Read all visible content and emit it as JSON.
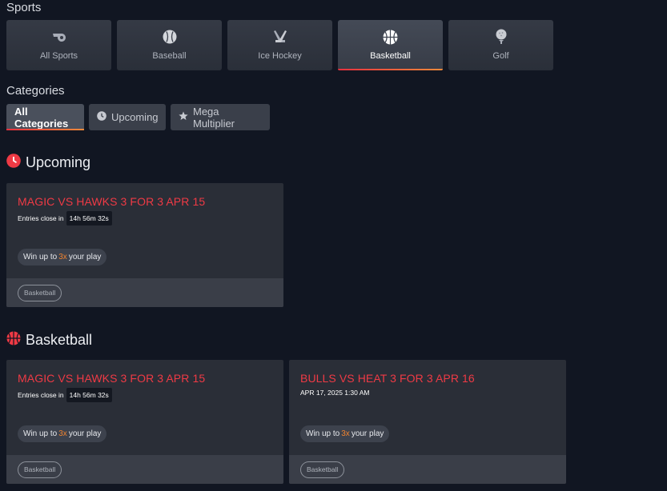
{
  "sports": {
    "title": "Sports",
    "items": [
      {
        "label": "All Sports",
        "icon": "whistle-icon"
      },
      {
        "label": "Baseball",
        "icon": "baseball-icon"
      },
      {
        "label": "Ice Hockey",
        "icon": "hockey-sticks-icon"
      },
      {
        "label": "Basketball",
        "icon": "basketball-icon",
        "active": true
      },
      {
        "label": "Golf",
        "icon": "golf-ball-icon"
      }
    ]
  },
  "categories": {
    "title": "Categories",
    "items": [
      {
        "label": "All Categories",
        "active": true
      },
      {
        "label": "Upcoming",
        "icon": "clock-icon"
      },
      {
        "label": "Mega Multiplier",
        "icon": "star-icon"
      }
    ]
  },
  "sections": {
    "upcoming": {
      "title": "Upcoming",
      "icon": "clock-icon",
      "cards": [
        {
          "title": "MAGIC VS HAWKS 3 FOR 3 APR 15",
          "sub_label": "Entries close in",
          "timer": "14h 56m 32s",
          "win_prefix": "Win up to",
          "multiplier": "3x",
          "win_suffix": "your play",
          "tag": "Basketball"
        }
      ]
    },
    "basketball": {
      "title": "Basketball",
      "icon": "basketball-icon",
      "cards": [
        {
          "title": "MAGIC VS HAWKS 3 FOR 3 APR 15",
          "sub_label": "Entries close in",
          "timer": "14h 56m 32s",
          "win_prefix": "Win up to",
          "multiplier": "3x",
          "win_suffix": "your play",
          "tag": "Basketball"
        },
        {
          "title": "BULLS VS HEAT 3 FOR 3 APR 16",
          "sub_label": "APR 17, 2025 1:30 AM",
          "win_prefix": "Win up to",
          "multiplier": "3x",
          "win_suffix": "your play",
          "tag": "Basketball"
        }
      ]
    }
  },
  "colors": {
    "background": "#111622",
    "accent_red": "#ef3a45",
    "accent_orange": "#f0832f",
    "tile": "#2a2f39"
  }
}
